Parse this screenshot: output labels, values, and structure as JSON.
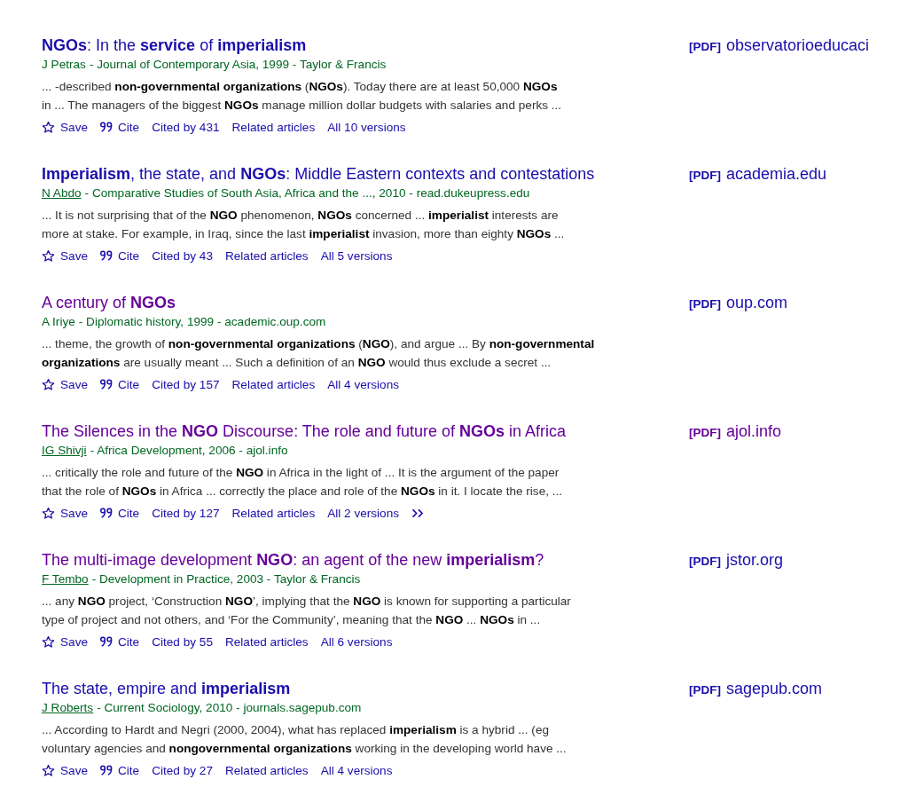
{
  "results": [
    {
      "title": "**NGOs**: In the **service** of **imperialism**",
      "visited": false,
      "author": "J Petras",
      "author_linked": false,
      "source": "- Journal of Contemporary Asia, 1999 - Taylor & Francis",
      "snippet": "... -described **non-governmental organizations** (**NGOs**). Today there are at least 50,000 **NGOs**\nin ... The managers of the biggest **NGOs** manage million dollar budgets with salaries and perks ...",
      "actions": [
        {
          "kind": "save",
          "label": "Save"
        },
        {
          "kind": "cite",
          "label": "Cite"
        },
        {
          "kind": "link",
          "label": "Cited by 431"
        },
        {
          "kind": "link",
          "label": "Related articles"
        },
        {
          "kind": "link",
          "label": "All 10 versions"
        }
      ],
      "more": false,
      "pdf": {
        "tag": "[PDF]",
        "domain": "observatorioeducaci",
        "visited": false
      }
    },
    {
      "title": "**Imperialism**, the state, and **NGOs**: Middle Eastern contexts and contestations",
      "visited": false,
      "author": "N Abdo",
      "author_linked": true,
      "source": "- Comparative Studies of South Asia, Africa and the ..., 2010 - read.dukeupress.edu",
      "snippet": "... It is not surprising that of the **NGO** phenomenon, **NGOs** concerned ... **imperialist** interests are\nmore at stake. For example, in Iraq, since the last **imperialist** invasion, more than eighty **NGOs** ...",
      "actions": [
        {
          "kind": "save",
          "label": "Save"
        },
        {
          "kind": "cite",
          "label": "Cite"
        },
        {
          "kind": "link",
          "label": "Cited by 43"
        },
        {
          "kind": "link",
          "label": "Related articles"
        },
        {
          "kind": "link",
          "label": "All 5 versions"
        }
      ],
      "more": false,
      "pdf": {
        "tag": "[PDF]",
        "domain": "academia.edu",
        "visited": false
      }
    },
    {
      "title": "A century of **NGOs**",
      "visited": true,
      "author": "A Iriye",
      "author_linked": false,
      "source": "- Diplomatic history, 1999 - academic.oup.com",
      "snippet": "... theme, the growth of **non-governmental organizations** (**NGO**), and argue ... By **non-governmental**\n**organizations** are usually meant ... Such a definition of an **NGO** would thus exclude a secret ...",
      "actions": [
        {
          "kind": "save",
          "label": "Save"
        },
        {
          "kind": "cite",
          "label": "Cite"
        },
        {
          "kind": "link",
          "label": "Cited by 157"
        },
        {
          "kind": "link",
          "label": "Related articles"
        },
        {
          "kind": "link",
          "label": "All 4 versions"
        }
      ],
      "more": false,
      "pdf": {
        "tag": "[PDF]",
        "domain": "oup.com",
        "visited": false
      }
    },
    {
      "title": "The Silences in the **NGO** Discourse: The role and future of **NGOs** in Africa",
      "visited": true,
      "author": "IG Shivji",
      "author_linked": true,
      "source": "- Africa Development, 2006 - ajol.info",
      "snippet": "... critically the role and future of the **NGO** in Africa in the light of ... It is the argument of the paper\nthat the role of **NGOs** in Africa ... correctly the place and role of the **NGOs** in it. I locate the rise, ...",
      "actions": [
        {
          "kind": "save",
          "label": "Save"
        },
        {
          "kind": "cite",
          "label": "Cite"
        },
        {
          "kind": "link",
          "label": "Cited by 127"
        },
        {
          "kind": "link",
          "label": "Related articles"
        },
        {
          "kind": "link",
          "label": "All 2 versions"
        }
      ],
      "more": true,
      "pdf": {
        "tag": "[PDF]",
        "domain": "ajol.info",
        "visited": true
      }
    },
    {
      "title": "The multi-image development **NGO**: an agent of the new **imperialism**?",
      "visited": true,
      "author": "F Tembo",
      "author_linked": true,
      "source": "- Development in Practice, 2003 - Taylor & Francis",
      "snippet": "... any **NGO** project, ‘Construction **NGO**’, implying that the **NGO** is known for supporting a particular\ntype of project and not others, and ‘For the Community’, meaning that the **NGO** ... **NGOs** in ...",
      "actions": [
        {
          "kind": "save",
          "label": "Save"
        },
        {
          "kind": "cite",
          "label": "Cite"
        },
        {
          "kind": "link",
          "label": "Cited by 55"
        },
        {
          "kind": "link",
          "label": "Related articles"
        },
        {
          "kind": "link",
          "label": "All 6 versions"
        }
      ],
      "more": false,
      "pdf": {
        "tag": "[PDF]",
        "domain": "jstor.org",
        "visited": false
      }
    },
    {
      "title": "The state, empire and **imperialism**",
      "visited": false,
      "author": "J Roberts",
      "author_linked": true,
      "source": "- Current Sociology, 2010 - journals.sagepub.com",
      "snippet": "... According to Hardt and Negri (2000, 2004), what has replaced **imperialism** is a hybrid ... (eg\nvoluntary agencies and **nongovernmental organizations** working in the developing world have ...",
      "actions": [
        {
          "kind": "save",
          "label": "Save"
        },
        {
          "kind": "cite",
          "label": "Cite"
        },
        {
          "kind": "link",
          "label": "Cited by 27"
        },
        {
          "kind": "link",
          "label": "Related articles"
        },
        {
          "kind": "link",
          "label": "All 4 versions"
        }
      ],
      "more": false,
      "pdf": {
        "tag": "[PDF]",
        "domain": "sagepub.com",
        "visited": false
      }
    }
  ]
}
